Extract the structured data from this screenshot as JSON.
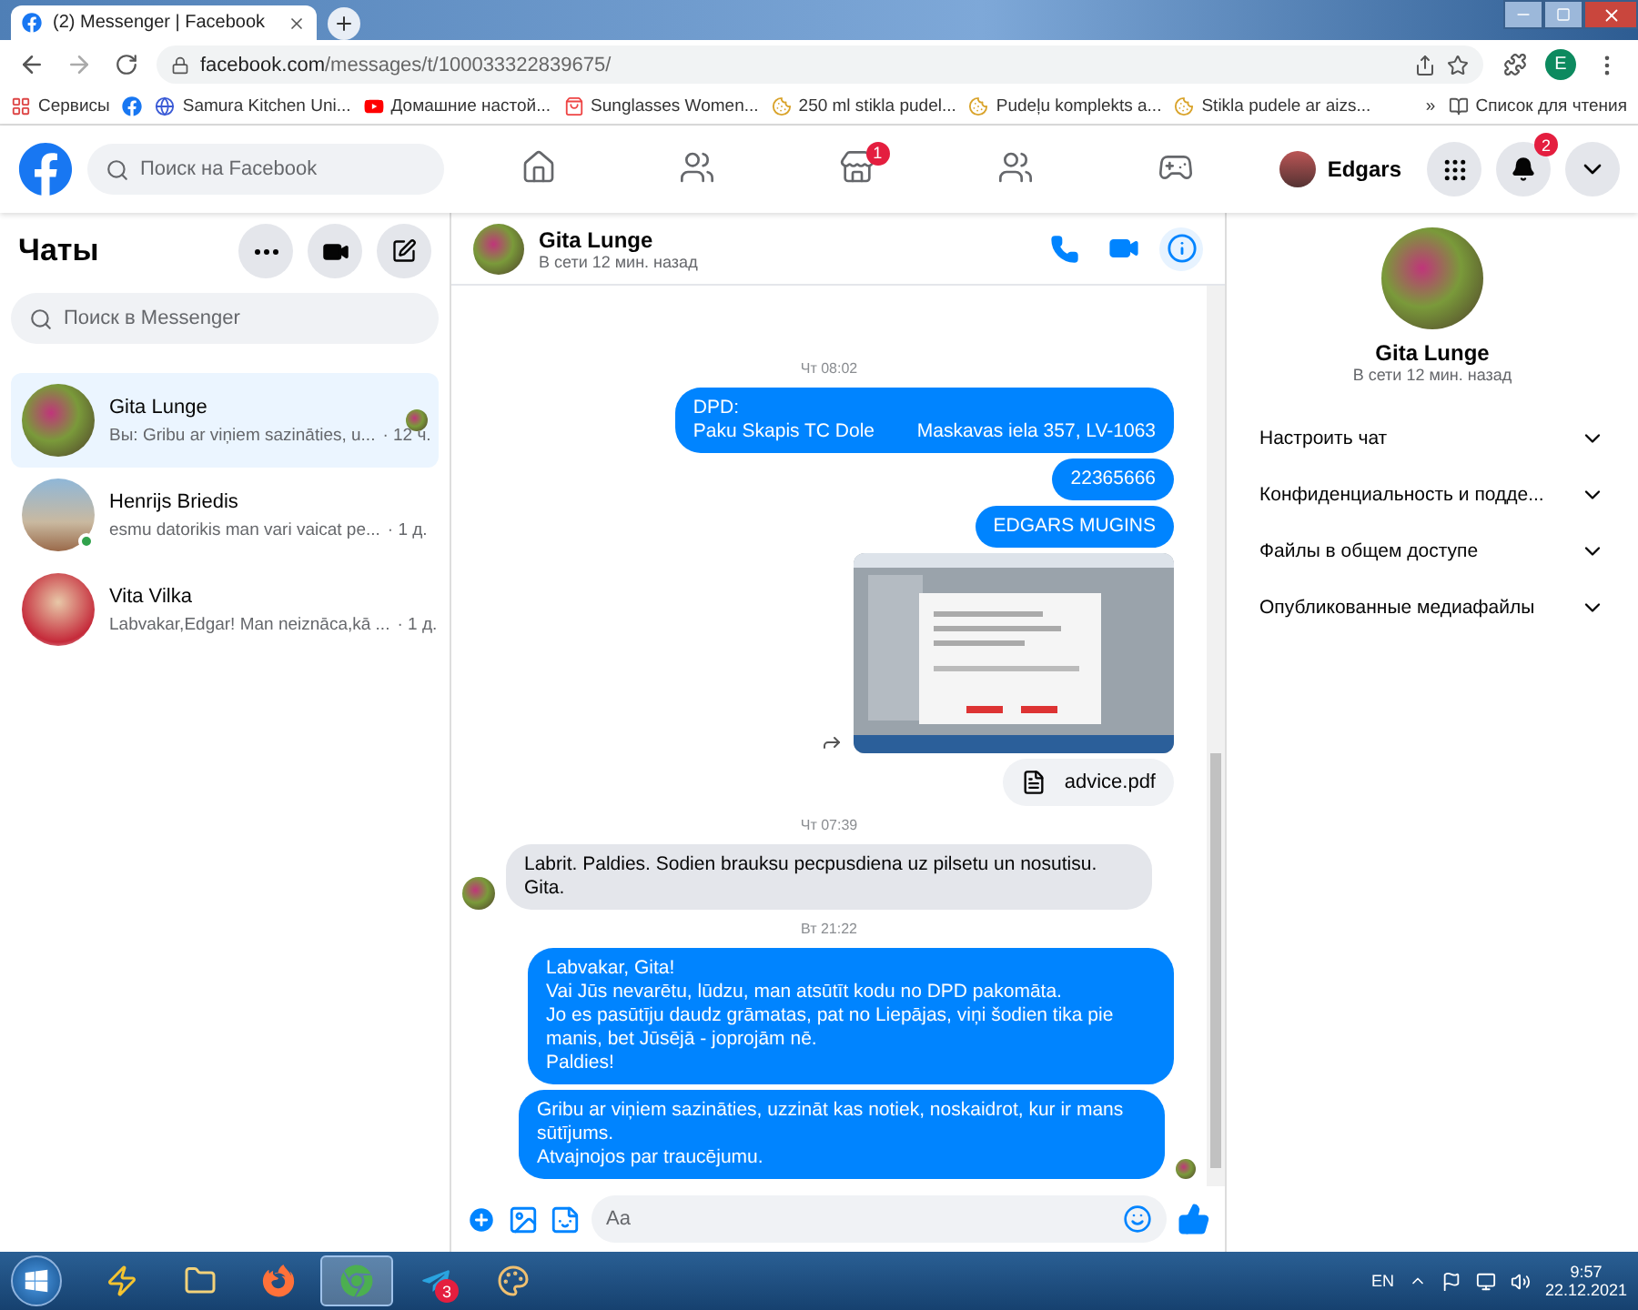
{
  "browser": {
    "tab_title": "(2) Messenger | Facebook",
    "url_host": "facebook.com",
    "url_path": "/messages/t/100033322839675/",
    "profile_initial": "E",
    "bookmarks": [
      {
        "kind": "apps",
        "label": "Сервисы"
      },
      {
        "kind": "facebook"
      },
      {
        "kind": "globe",
        "label": "Samura Kitchen Uni..."
      },
      {
        "kind": "video",
        "label": "Домашние настой..."
      },
      {
        "kind": "shop",
        "label": "Sunglasses Women..."
      },
      {
        "kind": "cookie",
        "label": "250 ml stikla pudel..."
      },
      {
        "kind": "cookie",
        "label": "Pudeļu komplekts a..."
      },
      {
        "kind": "cookie",
        "label": "Stikla pudele ar aizs..."
      }
    ],
    "more": "»",
    "reading_list": "Список для чтения"
  },
  "header": {
    "search_placeholder": "Поиск на Facebook",
    "nav": [
      {
        "kind": "home"
      },
      {
        "kind": "friends"
      },
      {
        "kind": "store",
        "badge": "1"
      },
      {
        "kind": "groups"
      },
      {
        "kind": "gaming"
      }
    ],
    "user": "Edgars",
    "notifications_badge": "2"
  },
  "sidebar": {
    "title": "Чаты",
    "search_placeholder": "Поиск в Messenger",
    "chats": [
      {
        "name": "Gita Lunge",
        "preview": "Вы: Gribu ar viņiem sazināties, u...",
        "time": "· 12 ч.",
        "selected": true,
        "online": false,
        "seen": true
      },
      {
        "name": "Henrijs Briedis",
        "preview": "esmu datorikis man vari vaicat pe...",
        "time": "· 1 д.",
        "selected": false,
        "online": true,
        "seen": false
      },
      {
        "name": "Vita Vilka",
        "preview": "Labvakar,Edgar! Man neiznāca,kā ...",
        "time": "· 1 д.",
        "selected": false,
        "online": false,
        "seen": false
      }
    ]
  },
  "chat": {
    "name": "Gita Lunge",
    "status": "В сети 12 мин. назад",
    "messages": [
      {
        "kind": "timestamp",
        "text": "Чт 08:02"
      },
      {
        "kind": "outgoing",
        "lines": [
          "DPD:",
          "Paku Skapis TC Dole        Maskavas iela 357, LV-1063"
        ]
      },
      {
        "kind": "outgoing",
        "lines": [
          "22365666"
        ]
      },
      {
        "kind": "outgoing",
        "lines": [
          "EDGARS MUGINS"
        ]
      },
      {
        "kind": "image"
      },
      {
        "kind": "file",
        "text": "advice.pdf"
      },
      {
        "kind": "timestamp",
        "text": "Чт 07:39"
      },
      {
        "kind": "incoming",
        "lines": [
          "Labrit. Paldies. Sodien brauksu pecpusdiena uz pilsetu un nosutisu. Gita."
        ]
      },
      {
        "kind": "timestamp",
        "text": "Вт 21:22"
      },
      {
        "kind": "outgoing",
        "lines": [
          "Labvakar, Gita!",
          "Vai Jūs nevarētu, lūdzu, man atsūtīt kodu no DPD pakomāta.",
          "Jo es pasūtīju daudz grāmatas, pat no Liepājas, viņi šodien tika pie manis, bet Jūsējā - joprojām nē.",
          "Paldies!"
        ]
      },
      {
        "kind": "outgoing",
        "lines": [
          "Gribu ar viņiem sazināties, uzzināt kas notiek, noskaidrot, kur ir mans sūtījums.",
          "Atvajnojos par traucējumu."
        ],
        "seen": true
      }
    ],
    "composer_placeholder": "Aa"
  },
  "info": {
    "name": "Gita Lunge",
    "status": "В сети 12 мин. назад",
    "sections": [
      {
        "label": "Настроить чат",
        "expanded": false
      },
      {
        "label": "Конфиденциальность и подде...",
        "expanded": false
      },
      {
        "label": "Файлы в общем доступе",
        "expanded": false
      },
      {
        "label": "Опубликованные медиафайлы",
        "expanded": false
      }
    ]
  },
  "taskbar": {
    "apps": [
      {
        "kind": "winamp"
      },
      {
        "kind": "folder"
      },
      {
        "kind": "firefox"
      },
      {
        "kind": "chrome",
        "selected": true
      },
      {
        "kind": "telegram",
        "badge": "3"
      },
      {
        "kind": "paint"
      }
    ],
    "language": "EN",
    "time": "9:57",
    "date": "22.12.2021"
  }
}
